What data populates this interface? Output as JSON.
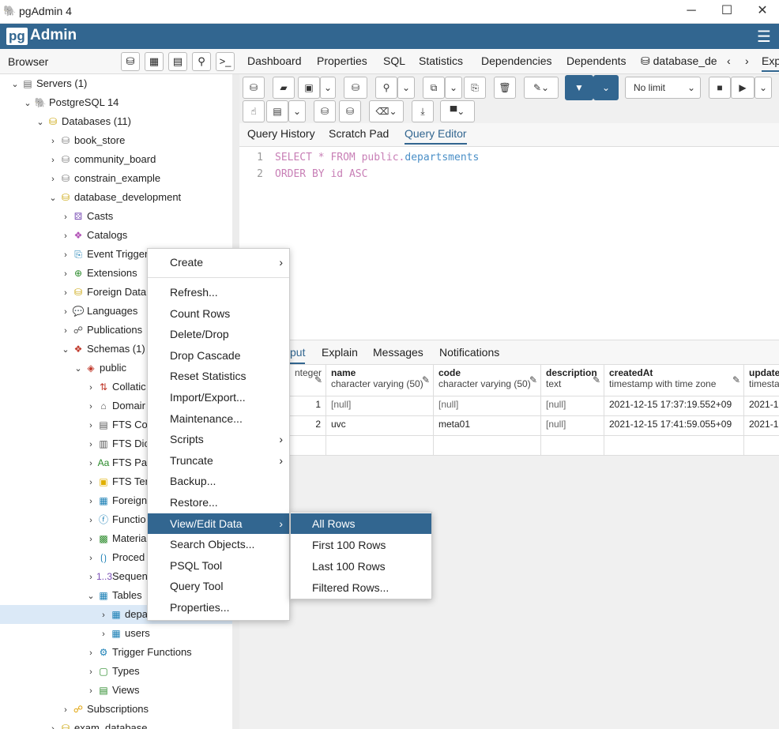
{
  "window": {
    "title": "pgAdmin 4",
    "minimize": "─",
    "maximize": "☐",
    "close": "✕"
  },
  "app": {
    "logo_box": "pg",
    "logo_text": "Admin"
  },
  "browser": {
    "label": "Browser"
  },
  "tree": [
    {
      "label": "Servers (1)",
      "icon": "server-icon",
      "glyph": "▤",
      "color": "#666",
      "chev": "⌄"
    },
    {
      "label": "PostgreSQL 14",
      "icon": "elephant-icon",
      "glyph": "🐘",
      "color": "#336791",
      "chev": "⌄"
    },
    {
      "label": "Databases (11)",
      "icon": "databases-icon",
      "glyph": "⛁",
      "color": "#c8a200",
      "chev": "⌄"
    },
    {
      "label": "book_store",
      "icon": "database-disconnected-icon",
      "glyph": "⛁",
      "color": "#777",
      "chev": "›"
    },
    {
      "label": "community_board",
      "icon": "database-disconnected-icon",
      "glyph": "⛁",
      "color": "#777",
      "chev": "›"
    },
    {
      "label": "constrain_example",
      "icon": "database-disconnected-icon",
      "glyph": "⛁",
      "color": "#777",
      "chev": "›"
    },
    {
      "label": "database_development",
      "icon": "database-icon",
      "glyph": "⛁",
      "color": "#c8a200",
      "chev": "⌄"
    },
    {
      "label": "Casts",
      "icon": "casts-icon",
      "glyph": "⚄",
      "color": "#7a4fb5",
      "chev": "›"
    },
    {
      "label": "Catalogs",
      "icon": "catalogs-icon",
      "glyph": "❖",
      "color": "#b04fb5",
      "chev": "›"
    },
    {
      "label": "Event Trigger",
      "icon": "event-trigger-icon",
      "glyph": "⎘",
      "color": "#1a7fb5",
      "chev": "›"
    },
    {
      "label": "Extensions",
      "icon": "extensions-icon",
      "glyph": "⊕",
      "color": "#2a8a2a",
      "chev": "›"
    },
    {
      "label": "Foreign Data",
      "icon": "foreign-data-icon",
      "glyph": "⛁",
      "color": "#c8a200",
      "chev": "›"
    },
    {
      "label": "Languages",
      "icon": "languages-icon",
      "glyph": "💬",
      "color": "#e0b000",
      "chev": "›"
    },
    {
      "label": "Publications",
      "icon": "publications-icon",
      "glyph": "☍",
      "color": "#555",
      "chev": "›"
    },
    {
      "label": "Schemas (1)",
      "icon": "schemas-icon",
      "glyph": "❖",
      "color": "#c0392b",
      "chev": "⌄"
    },
    {
      "label": "public",
      "icon": "schema-icon",
      "glyph": "◈",
      "color": "#c0392b",
      "chev": "⌄"
    },
    {
      "label": "Collatic",
      "icon": "collations-icon",
      "glyph": "⇅",
      "color": "#c0392b",
      "chev": "›"
    },
    {
      "label": "Domair",
      "icon": "domains-icon",
      "glyph": "⌂",
      "color": "#555",
      "chev": "›"
    },
    {
      "label": "FTS Co",
      "icon": "fts-config-icon",
      "glyph": "▤",
      "color": "#555",
      "chev": "›"
    },
    {
      "label": "FTS Dic",
      "icon": "fts-dictionary-icon",
      "glyph": "▥",
      "color": "#555",
      "chev": "›"
    },
    {
      "label": "FTS Pa",
      "icon": "fts-parser-icon",
      "glyph": "Aa",
      "color": "#2a8a2a",
      "chev": "›"
    },
    {
      "label": "FTS Ter",
      "icon": "fts-template-icon",
      "glyph": "▣",
      "color": "#e0b000",
      "chev": "›"
    },
    {
      "label": "Foreign",
      "icon": "foreign-table-icon",
      "glyph": "▦",
      "color": "#1a7fb5",
      "chev": "›"
    },
    {
      "label": "Functio",
      "icon": "functions-icon",
      "glyph": "ⓕ",
      "color": "#1a7fb5",
      "chev": "›"
    },
    {
      "label": "Materia",
      "icon": "materialized-views-icon",
      "glyph": "▩",
      "color": "#2a8a2a",
      "chev": "›"
    },
    {
      "label": "Proced",
      "icon": "procedures-icon",
      "glyph": "⟮⟯",
      "color": "#1a7fb5",
      "chev": "›"
    },
    {
      "label": "Sequen",
      "icon": "sequences-icon",
      "glyph": "1..3",
      "color": "#7a4fb5",
      "chev": "›"
    },
    {
      "label": "Tables",
      "icon": "tables-icon",
      "glyph": "▦",
      "color": "#1a7fb5",
      "chev": "⌄"
    },
    {
      "label": "depa",
      "icon": "table-icon",
      "glyph": "▦",
      "color": "#1a7fb5",
      "chev": "›"
    },
    {
      "label": "users",
      "icon": "table-icon",
      "glyph": "▦",
      "color": "#1a7fb5",
      "chev": "›"
    },
    {
      "label": "Trigger Functions",
      "icon": "trigger-functions-icon",
      "glyph": "⚙",
      "color": "#1a7fb5",
      "chev": "›"
    },
    {
      "label": "Types",
      "icon": "types-icon",
      "glyph": "▢",
      "color": "#2a8a2a",
      "chev": "›"
    },
    {
      "label": "Views",
      "icon": "views-icon",
      "glyph": "▤",
      "color": "#2a8a2a",
      "chev": "›"
    },
    {
      "label": "Subscriptions",
      "icon": "subscriptions-icon",
      "glyph": "☍",
      "color": "#e0a000",
      "chev": "›"
    },
    {
      "label": "exam_database",
      "icon": "database-icon",
      "glyph": "⛁",
      "color": "#c8a200",
      "chev": "›"
    }
  ],
  "main_tabs": [
    "Dashboard",
    "Properties",
    "SQL",
    "Statistics",
    "Dependencies",
    "Dependents",
    "database_de",
    "Expl"
  ],
  "toolbar": {
    "limit": "No limit"
  },
  "editor_tabs": [
    "Query History",
    "Scratch Pad",
    "Query Editor"
  ],
  "editor": {
    "line1_no": "1",
    "line2_no": "2",
    "l1_select": "SELECT",
    "l1_star": " * ",
    "l1_from": "FROM",
    "l1_schema": " public.",
    "l1_table": "departsments",
    "l2_order": "ORDER BY",
    "l2_col": " id ",
    "l2_asc": "ASC"
  },
  "result_tabs": [
    "put",
    "Explain",
    "Messages",
    "Notifications"
  ],
  "grid": {
    "columns": [
      {
        "name": "",
        "type": "nteger"
      },
      {
        "name": "name",
        "type": "character varying (50)"
      },
      {
        "name": "code",
        "type": "character varying (50)"
      },
      {
        "name": "description",
        "type": "text"
      },
      {
        "name": "createdAt",
        "type": "timestamp with time zone"
      },
      {
        "name": "update",
        "type": "timesta"
      }
    ],
    "rows": [
      [
        "1",
        "[null]",
        "[null]",
        "[null]",
        "2021-12-15 17:37:19.552+09",
        "2021-1"
      ],
      [
        "2",
        "uvc",
        "meta01",
        "[null]",
        "2021-12-15 17:41:59.055+09",
        "2021-1"
      ]
    ]
  },
  "context_menu": {
    "items": [
      "Create",
      "Refresh...",
      "Count Rows",
      "Delete/Drop",
      "Drop Cascade",
      "Reset Statistics",
      "Import/Export...",
      "Maintenance...",
      "Scripts",
      "Truncate",
      "Backup...",
      "Restore...",
      "View/Edit Data",
      "Search Objects...",
      "PSQL Tool",
      "Query Tool",
      "Properties..."
    ]
  },
  "submenu": {
    "items": [
      "All Rows",
      "First 100 Rows",
      "Last 100 Rows",
      "Filtered Rows..."
    ]
  },
  "colors": {
    "brand": "#326690",
    "highlight": "#326690",
    "selection": "#dbe9f7"
  }
}
